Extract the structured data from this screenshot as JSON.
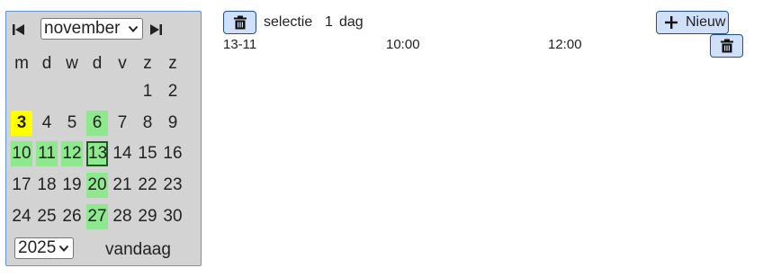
{
  "calendar": {
    "month": "november",
    "year": "2025",
    "weekdays": [
      "m",
      "d",
      "w",
      "d",
      "v",
      "z",
      "z"
    ],
    "today_label": "vandaag",
    "days": [
      {
        "label": "1",
        "state": "normal"
      },
      {
        "label": "2",
        "state": "normal"
      },
      {
        "label": "3",
        "state": "today"
      },
      {
        "label": "4",
        "state": "normal"
      },
      {
        "label": "5",
        "state": "normal"
      },
      {
        "label": "6",
        "state": "event"
      },
      {
        "label": "7",
        "state": "normal"
      },
      {
        "label": "8",
        "state": "normal"
      },
      {
        "label": "9",
        "state": "normal"
      },
      {
        "label": "10",
        "state": "event"
      },
      {
        "label": "11",
        "state": "event"
      },
      {
        "label": "12",
        "state": "event"
      },
      {
        "label": "13",
        "state": "selected-event"
      },
      {
        "label": "14",
        "state": "normal"
      },
      {
        "label": "15",
        "state": "normal"
      },
      {
        "label": "16",
        "state": "normal"
      },
      {
        "label": "17",
        "state": "normal"
      },
      {
        "label": "18",
        "state": "normal"
      },
      {
        "label": "19",
        "state": "normal"
      },
      {
        "label": "20",
        "state": "event"
      },
      {
        "label": "21",
        "state": "normal"
      },
      {
        "label": "22",
        "state": "normal"
      },
      {
        "label": "23",
        "state": "normal"
      },
      {
        "label": "24",
        "state": "normal"
      },
      {
        "label": "25",
        "state": "normal"
      },
      {
        "label": "26",
        "state": "normal"
      },
      {
        "label": "27",
        "state": "event"
      },
      {
        "label": "28",
        "state": "normal"
      },
      {
        "label": "29",
        "state": "normal"
      },
      {
        "label": "30",
        "state": "normal"
      }
    ],
    "first_weekday_index": 5,
    "colors": {
      "event": "#8ee88e",
      "today": "#ffff00",
      "panel": "#d3d3d3"
    }
  },
  "selection": {
    "label": "selectie",
    "count": "1",
    "unit": "dag"
  },
  "toolbar": {
    "new_label": "Nieuw"
  },
  "events": [
    {
      "date": "13-11",
      "start": "10:00",
      "end": "12:00"
    }
  ],
  "icons": {
    "prev": "skip-previous-icon",
    "next": "skip-next-icon",
    "delete": "trash-icon",
    "add": "plus-icon"
  }
}
